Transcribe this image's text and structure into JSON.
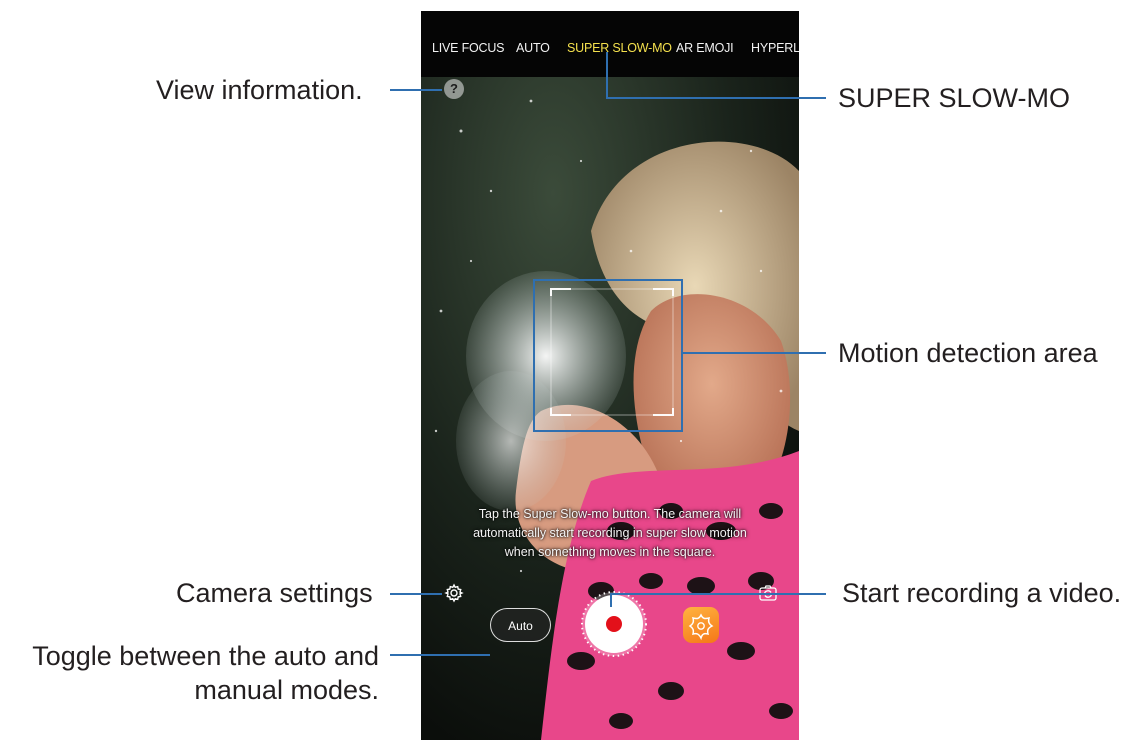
{
  "callouts": {
    "view_information": "View information.",
    "super_slow_mo": "SUPER SLOW-MO",
    "motion_detection_area": "Motion detection area",
    "camera_settings": "Camera settings",
    "start_recording": "Start recording a video.",
    "toggle_line1": "Toggle between the auto and",
    "toggle_line2": "manual modes."
  },
  "camera": {
    "modes": [
      "LIVE FOCUS",
      "AUTO",
      "SUPER SLOW-MO",
      "AR EMOJI",
      "HYPERLA"
    ],
    "active_mode": "SUPER SLOW-MO",
    "info_symbol": "?",
    "hint_line1": "Tap the Super Slow-mo button. The camera will",
    "hint_line2": "automatically start recording in super slow motion",
    "hint_line3": "when something moves in the square.",
    "auto_label": "Auto"
  },
  "colors": {
    "callout_line": "#2f6fb0",
    "active_mode": "#f4e04d",
    "record_dot": "#e3101a",
    "gallery_icon": "#f57718"
  },
  "icons": {
    "info": "question-icon",
    "settings": "gear-icon",
    "switch_camera": "switch-camera-icon",
    "gallery": "gallery-icon",
    "record": "record-icon"
  }
}
